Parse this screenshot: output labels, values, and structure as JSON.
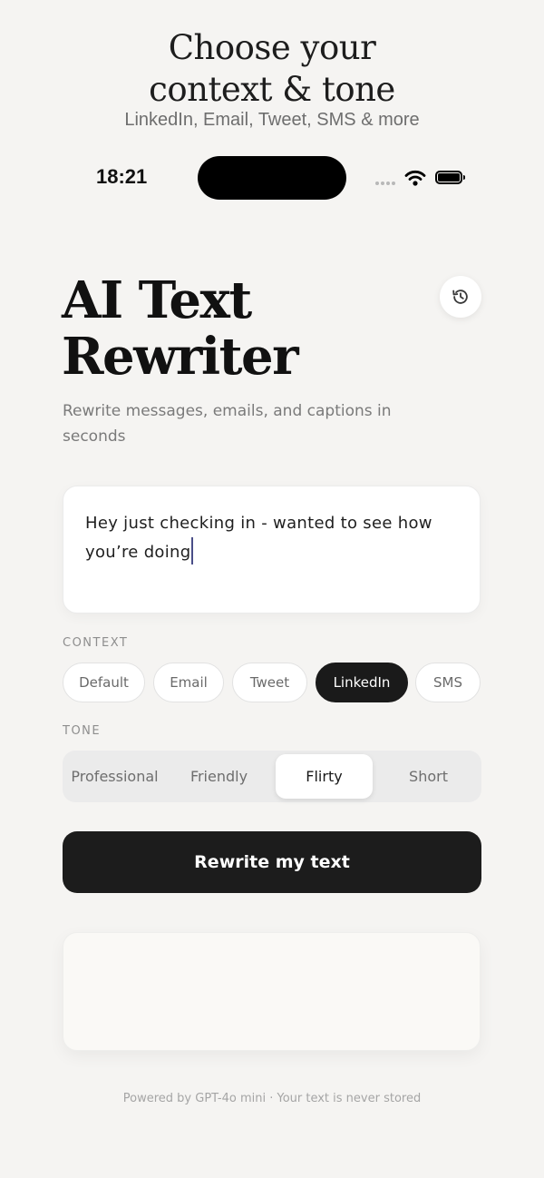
{
  "promo": {
    "title_line1": "Choose your",
    "title_line2": "context & tone",
    "subtitle": "LinkedIn, Email, Tweet, SMS & more"
  },
  "status_bar": {
    "time": "18:21",
    "icons": [
      "signal-dots-icon",
      "wifi-icon",
      "battery-icon"
    ]
  },
  "header": {
    "title_line1": "AI Text",
    "title_line2": "Rewriter",
    "subtitle": "Rewrite messages, emails, and captions in seconds",
    "history_icon": "history-icon"
  },
  "input": {
    "value": "Hey just checking in - wanted to see how you’re doing"
  },
  "context": {
    "label": "CONTEXT",
    "options": [
      "Default",
      "Email",
      "Tweet",
      "LinkedIn",
      "SMS"
    ],
    "selected": "LinkedIn"
  },
  "tone": {
    "label": "TONE",
    "options": [
      "Professional",
      "Friendly",
      "Flirty",
      "Short"
    ],
    "selected": "Flirty"
  },
  "action": {
    "rewrite_label": "Rewrite my text"
  },
  "output": {
    "value": ""
  },
  "footer": {
    "note": "Powered by GPT-4o mini · Your text is never stored"
  },
  "colors": {
    "background": "#f5f4f2",
    "primary_dark": "#1c1c1c",
    "caret": "#4a4e88"
  }
}
